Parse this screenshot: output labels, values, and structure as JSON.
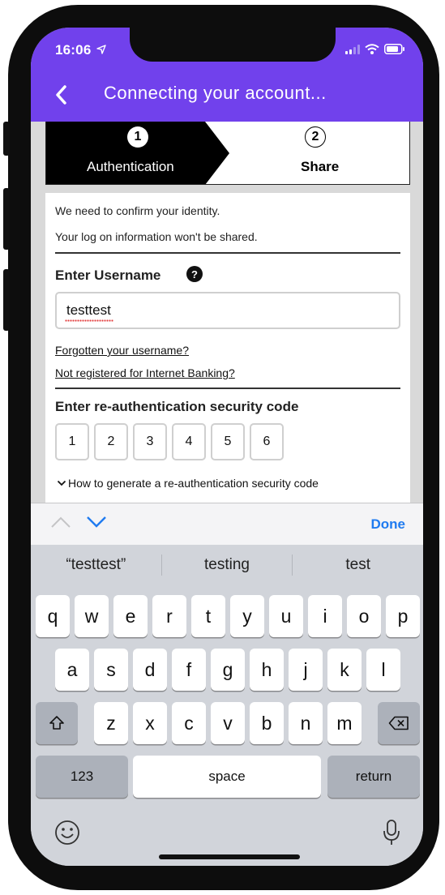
{
  "status_bar": {
    "time": "16:06"
  },
  "header": {
    "title": "Connecting your account..."
  },
  "steps": [
    {
      "number": "1",
      "label": "Authentication"
    },
    {
      "number": "2",
      "label": "Share"
    }
  ],
  "form": {
    "intro_1": "We need to confirm your identity.",
    "intro_2": "Your log on information won't be shared.",
    "username_label": "Enter Username",
    "help_glyph": "?",
    "username_value": "testtest",
    "forgot_link": "Forgotten your username?",
    "register_link": "Not registered for Internet Banking?",
    "code_label": "Enter re-authentication security code",
    "code_digits": [
      "1",
      "2",
      "3",
      "4",
      "5",
      "6"
    ],
    "how_to": "How to generate a re-authentication security code"
  },
  "accessory": {
    "done_label": "Done"
  },
  "keyboard": {
    "suggestions": [
      "“testtest”",
      "testing",
      "test"
    ],
    "row1": [
      "q",
      "w",
      "e",
      "r",
      "t",
      "y",
      "u",
      "i",
      "o",
      "p"
    ],
    "row2": [
      "a",
      "s",
      "d",
      "f",
      "g",
      "h",
      "j",
      "k",
      "l"
    ],
    "row3": [
      "z",
      "x",
      "c",
      "v",
      "b",
      "n",
      "m"
    ],
    "numbers_label": "123",
    "space_label": "space",
    "return_label": "return"
  },
  "colors": {
    "brand": "#7141ec",
    "link_blue": "#1f7bf0"
  }
}
